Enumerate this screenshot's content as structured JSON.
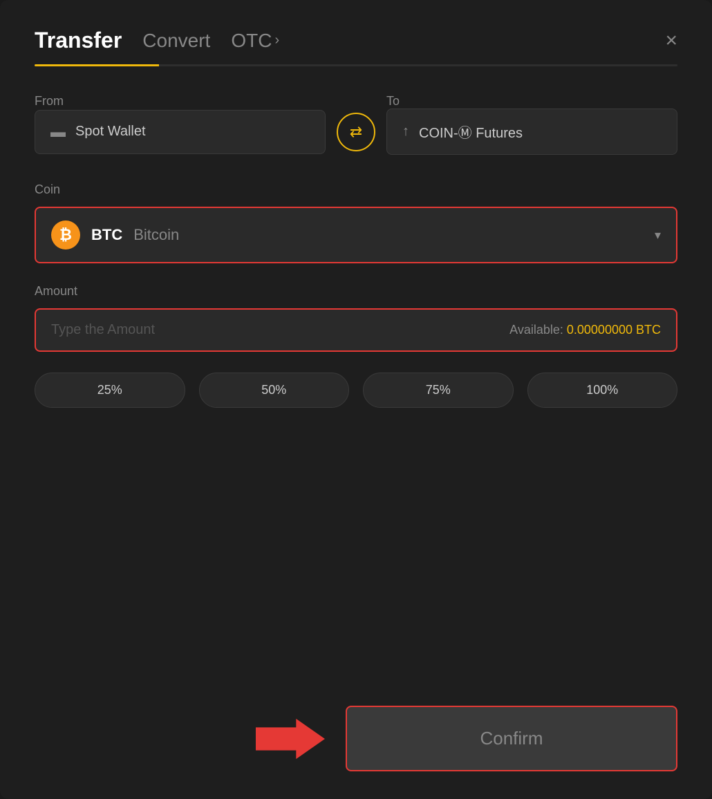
{
  "header": {
    "tab_transfer": "Transfer",
    "tab_convert": "Convert",
    "tab_otc": "OTC",
    "close_label": "×"
  },
  "from": {
    "label": "From",
    "wallet_icon": "▬",
    "wallet_name": "Spot Wallet"
  },
  "to": {
    "label": "To",
    "futures_icon": "↑",
    "futures_name": "COIN-Ⓜ Futures"
  },
  "coin": {
    "label": "Coin",
    "symbol": "BTC",
    "name": "Bitcoin",
    "dropdown_icon": "▾"
  },
  "amount": {
    "label": "Amount",
    "placeholder": "Type the Amount",
    "available_label": "Available:",
    "available_value": "0.00000000 BTC"
  },
  "percent_buttons": [
    "25%",
    "50%",
    "75%",
    "100%"
  ],
  "confirm": {
    "label": "Confirm"
  }
}
